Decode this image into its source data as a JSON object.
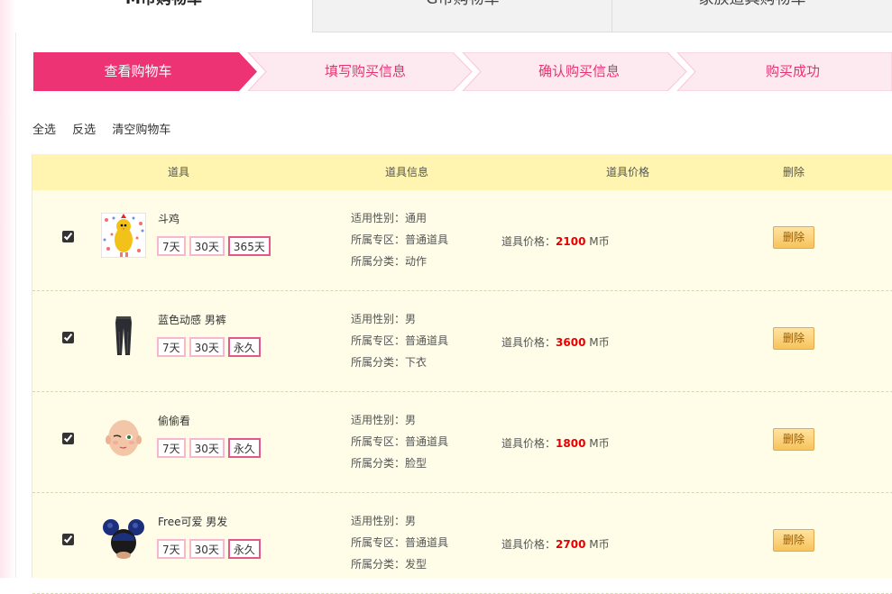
{
  "tabs": [
    {
      "label": "M币购物车",
      "active": true
    },
    {
      "label": "G币购物车",
      "active": false
    },
    {
      "label": "家族道具购物车",
      "active": false
    }
  ],
  "steps": [
    {
      "label": "查看购物车",
      "active": true
    },
    {
      "label": "填写购买信息",
      "active": false
    },
    {
      "label": "确认购买信息",
      "active": false
    },
    {
      "label": "购买成功",
      "active": false
    }
  ],
  "select_actions": {
    "all": "全选",
    "invert": "反选",
    "clear": "清空购物车"
  },
  "columns": {
    "item": "道具",
    "info": "道具信息",
    "price": "道具价格",
    "delete": "删除"
  },
  "labels": {
    "gender": "适用性别：",
    "zone": "所属专区：",
    "category": "所属分类：",
    "price": "道具价格：",
    "currency": "M币",
    "delete": "删除"
  },
  "colors": {
    "accent": "#ee3375",
    "step_idle": "#fde9f0",
    "header_bg": "#fff5b1"
  },
  "items": [
    {
      "name": "斗鸡",
      "icon": "rooster-costume-icon",
      "durations": [
        "7天",
        "30天",
        "365天"
      ],
      "selected_duration": 2,
      "gender": "通用",
      "zone": "普通道具",
      "category": "动作",
      "price": "2100",
      "checked": true
    },
    {
      "name": "蓝色动感 男裤",
      "icon": "pants-icon",
      "durations": [
        "7天",
        "30天",
        "永久"
      ],
      "selected_duration": 2,
      "gender": "男",
      "zone": "普通道具",
      "category": "下衣",
      "price": "3600",
      "checked": true
    },
    {
      "name": "偷偷看",
      "icon": "face-icon",
      "durations": [
        "7天",
        "30天",
        "永久"
      ],
      "selected_duration": 2,
      "gender": "男",
      "zone": "普通道具",
      "category": "脸型",
      "price": "1800",
      "checked": true
    },
    {
      "name": "Free可爱 男发",
      "icon": "mouse-ears-hair-icon",
      "durations": [
        "7天",
        "30天",
        "永久"
      ],
      "selected_duration": 2,
      "gender": "男",
      "zone": "普通道具",
      "category": "发型",
      "price": "2700",
      "checked": true
    }
  ]
}
